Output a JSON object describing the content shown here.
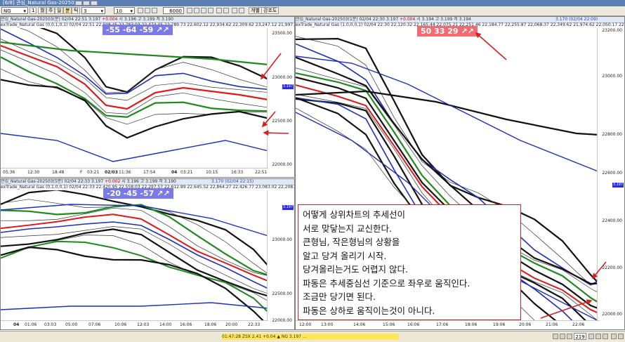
{
  "window": {
    "title": "[6/8] 관심_Natural Gas-202503..."
  },
  "toolbar": {
    "symbol": "NG",
    "tab_index": "1",
    "fields": [
      "월",
      "주",
      "일",
      "분",
      "틱"
    ],
    "period": "3",
    "count": "10",
    "bars": "6000",
    "apply": "개별",
    "settings": "강조도"
  },
  "panels": {
    "top_left": {
      "header_name": "관심_Natural Gas-202503(분)",
      "header_date": "02/04 22:51",
      "header_price": "3.197",
      "header_change": "+0.004",
      "header_ohlc": "시 3.196 고 3.199 저 3.190",
      "legend": "exTrade_Natural Gas (0,0,1,0,1) 02/04 22:51 22,598.45 22,783.03 22,474.45 22,289.73 22,602.12 22,934.62 22,309.62 23,247.12 21,997.12",
      "badge": "-55  -64  -59  ↗↗",
      "price_ticks": [
        "23500.00",
        "23000.00",
        "22500.00",
        "22000.00"
      ],
      "price_tag": "3.197",
      "time_labels": [
        {
          "t": "05:36",
          "b": false
        },
        {
          "t": "12:30",
          "b": false
        },
        {
          "t": "18:48",
          "b": false
        },
        {
          "t": "F",
          "b": false
        },
        {
          "t": "03:21",
          "b": false
        },
        {
          "t": "02/03",
          "b": true
        },
        {
          "t": "11:36",
          "b": false
        },
        {
          "t": "17:54",
          "b": false
        },
        {
          "t": "04",
          "b": true
        },
        {
          "t": "03:21",
          "b": false
        },
        {
          "t": "10:15",
          "b": false
        },
        {
          "t": "16:33",
          "b": false
        },
        {
          "t": "22:51",
          "b": false
        }
      ]
    },
    "bottom_left": {
      "header_name": "관심_Natural Gas-202503(5분)",
      "header_date": "02/04 22:33",
      "header_price": "3.197",
      "header_change": "+0.002",
      "header_ohlc": "시 3.196 고 3.199 저 3.190",
      "header_right": "3.170 (02/04 22:15)",
      "legend": "exTrade_Natural Gas (0,1,0,0,1) 02/04 22:33 22,420.95 22,558.03 22,297.57 22,612.89 22,645.52 22,864.27 22,426.77 23,083.02 22,208.02",
      "badge": "-20  -45  -57  ↗↗",
      "price_ticks": [
        "23000.00",
        "22500.00",
        "22000.00"
      ],
      "price_tag": "3.197",
      "time_labels": [
        {
          "t": "04",
          "b": true
        },
        {
          "t": "01:06",
          "b": false
        },
        {
          "t": "03:03",
          "b": false
        },
        {
          "t": "05:00",
          "b": false
        },
        {
          "t": "07:06",
          "b": false
        },
        {
          "t": "10:06",
          "b": false
        },
        {
          "t": "12:03",
          "b": false
        },
        {
          "t": "14:00",
          "b": false
        },
        {
          "t": "16:06",
          "b": false
        },
        {
          "t": "18:06",
          "b": false
        },
        {
          "t": "20:00",
          "b": false
        },
        {
          "t": "22:33",
          "b": false
        }
      ]
    },
    "right": {
      "header_name": "관심_Natural Gas-202503(1분)",
      "header_date": "02/04 22:30",
      "header_price": "3.197",
      "header_change": "+0.004",
      "header_ohlc": "시 3.194 고 3.199 저 3.194",
      "header_right": "3.170 (02/04 22:09)",
      "legend": "exTrade_Natural Gas (1,0,0,0,1) 02/04 22:30 22,120.32 22,165.44 22,075.21 22,251.46 22,184.77 22,255.87 22,068.37 22,349.62 21,974.62 22,050.17 22,45",
      "badge": "50  33  29  ↗↗",
      "price_ticks": [
        "23200.00",
        "23000.00",
        "22800.00",
        "22600.00",
        "22400.00",
        "22200.00",
        "22000.00"
      ],
      "price_tag": "3.197",
      "time_labels": [
        {
          "t": "12:00",
          "b": false
        },
        {
          "t": "13:00",
          "b": false
        },
        {
          "t": "14:06",
          "b": false
        },
        {
          "t": "15:06",
          "b": false
        },
        {
          "t": "16:06",
          "b": false
        },
        {
          "t": "17:06",
          "b": false
        },
        {
          "t": "18:06",
          "b": false
        },
        {
          "t": "19:06",
          "b": false
        },
        {
          "t": "20:06",
          "b": false
        },
        {
          "t": "21:06",
          "b": false
        },
        {
          "t": "22:06",
          "b": false
        }
      ]
    }
  },
  "annotation": {
    "lines": [
      "어떻게 상위차트의 추세선이",
      "서로 맞닿는지 교신한다.",
      "큰형님, 작은형님의 상황을",
      "알고 당겨 올리기 시작.",
      "당겨올리는거도 어렵지 않다.",
      "파동은 추세중심선 기준으로 좌우로 움직인다.",
      "조금만 당기면 된다.",
      "파동은 상하로 움직이는것이 아니다."
    ]
  },
  "statusbar": {
    "ticker": "01:47:28  ZSX 2.41  +0.04  ▲  NG 3.197  …",
    "page": "219"
  },
  "colors": {
    "black_line": "#111111",
    "blue_line": "#1f2fb8",
    "red_line": "#e01818",
    "green_line": "#1e8a1e",
    "thin_line": "#333333",
    "annotation_arrow": "#d42020"
  }
}
